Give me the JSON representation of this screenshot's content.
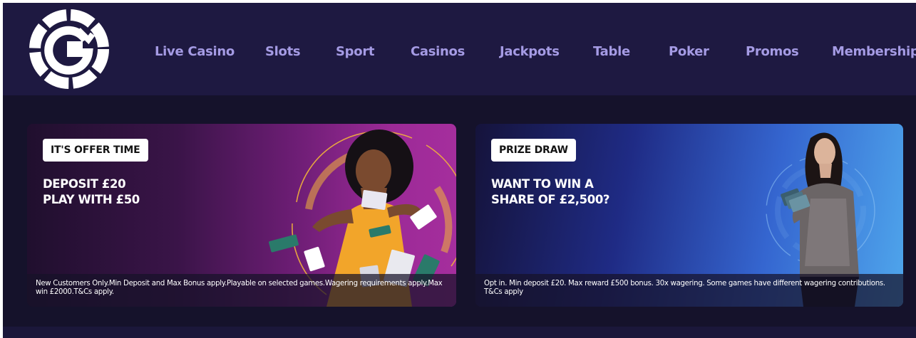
{
  "brand": {
    "logo_icon": "g-chip-logo-icon",
    "colors": {
      "header_bg": "#1e1941",
      "page_bg": "#14112a",
      "nav_text": "#a59be4",
      "logo_fill": "#ffffff"
    }
  },
  "nav": {
    "items": [
      {
        "label": "Live Casino"
      },
      {
        "label": "Slots"
      },
      {
        "label": "Sport"
      },
      {
        "label": "Casinos"
      },
      {
        "label": "Jackpots"
      },
      {
        "label": "Table"
      },
      {
        "label": "Poker"
      },
      {
        "label": "Promos"
      },
      {
        "label": "Membership"
      }
    ]
  },
  "promos": [
    {
      "badge": "IT'S OFFER TIME",
      "headline_line1": "DEPOSIT £20",
      "headline_line2": "PLAY WITH £50",
      "disclaimer": "New Customers Only.Min Deposit and Max Bonus apply.Playable on selected games.Wagering requirements apply.Max win £2000.T&Cs apply.",
      "colors": {
        "bg_start": "#200f2e",
        "bg_end": "#a52e9d",
        "accent_ring": "#f2b43a"
      }
    },
    {
      "badge": "PRIZE DRAW",
      "headline_line1": "WANT TO WIN A",
      "headline_line2": "SHARE OF £2,500?",
      "disclaimer": "Opt in. Min deposit £20. Max reward £500 bonus. 30x wagering. Some games have different wagering contributions. T&Cs apply",
      "colors": {
        "bg_start": "#15133b",
        "bg_end": "#4fa6ec"
      }
    }
  ]
}
